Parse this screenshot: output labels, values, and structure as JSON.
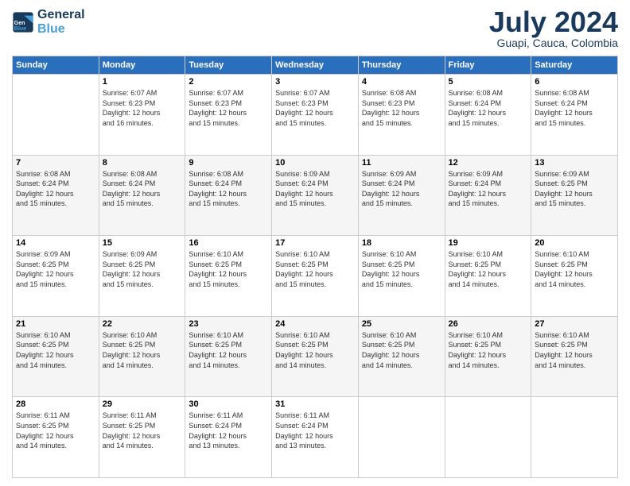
{
  "header": {
    "logo_line1": "General",
    "logo_line2": "Blue",
    "month": "July 2024",
    "location": "Guapi, Cauca, Colombia"
  },
  "weekdays": [
    "Sunday",
    "Monday",
    "Tuesday",
    "Wednesday",
    "Thursday",
    "Friday",
    "Saturday"
  ],
  "weeks": [
    [
      {
        "day": "",
        "info": ""
      },
      {
        "day": "1",
        "info": "Sunrise: 6:07 AM\nSunset: 6:23 PM\nDaylight: 12 hours\nand 16 minutes."
      },
      {
        "day": "2",
        "info": "Sunrise: 6:07 AM\nSunset: 6:23 PM\nDaylight: 12 hours\nand 15 minutes."
      },
      {
        "day": "3",
        "info": "Sunrise: 6:07 AM\nSunset: 6:23 PM\nDaylight: 12 hours\nand 15 minutes."
      },
      {
        "day": "4",
        "info": "Sunrise: 6:08 AM\nSunset: 6:23 PM\nDaylight: 12 hours\nand 15 minutes."
      },
      {
        "day": "5",
        "info": "Sunrise: 6:08 AM\nSunset: 6:24 PM\nDaylight: 12 hours\nand 15 minutes."
      },
      {
        "day": "6",
        "info": "Sunrise: 6:08 AM\nSunset: 6:24 PM\nDaylight: 12 hours\nand 15 minutes."
      }
    ],
    [
      {
        "day": "7",
        "info": "Sunrise: 6:08 AM\nSunset: 6:24 PM\nDaylight: 12 hours\nand 15 minutes."
      },
      {
        "day": "8",
        "info": "Sunrise: 6:08 AM\nSunset: 6:24 PM\nDaylight: 12 hours\nand 15 minutes."
      },
      {
        "day": "9",
        "info": "Sunrise: 6:08 AM\nSunset: 6:24 PM\nDaylight: 12 hours\nand 15 minutes."
      },
      {
        "day": "10",
        "info": "Sunrise: 6:09 AM\nSunset: 6:24 PM\nDaylight: 12 hours\nand 15 minutes."
      },
      {
        "day": "11",
        "info": "Sunrise: 6:09 AM\nSunset: 6:24 PM\nDaylight: 12 hours\nand 15 minutes."
      },
      {
        "day": "12",
        "info": "Sunrise: 6:09 AM\nSunset: 6:24 PM\nDaylight: 12 hours\nand 15 minutes."
      },
      {
        "day": "13",
        "info": "Sunrise: 6:09 AM\nSunset: 6:25 PM\nDaylight: 12 hours\nand 15 minutes."
      }
    ],
    [
      {
        "day": "14",
        "info": "Sunrise: 6:09 AM\nSunset: 6:25 PM\nDaylight: 12 hours\nand 15 minutes."
      },
      {
        "day": "15",
        "info": "Sunrise: 6:09 AM\nSunset: 6:25 PM\nDaylight: 12 hours\nand 15 minutes."
      },
      {
        "day": "16",
        "info": "Sunrise: 6:10 AM\nSunset: 6:25 PM\nDaylight: 12 hours\nand 15 minutes."
      },
      {
        "day": "17",
        "info": "Sunrise: 6:10 AM\nSunset: 6:25 PM\nDaylight: 12 hours\nand 15 minutes."
      },
      {
        "day": "18",
        "info": "Sunrise: 6:10 AM\nSunset: 6:25 PM\nDaylight: 12 hours\nand 15 minutes."
      },
      {
        "day": "19",
        "info": "Sunrise: 6:10 AM\nSunset: 6:25 PM\nDaylight: 12 hours\nand 14 minutes."
      },
      {
        "day": "20",
        "info": "Sunrise: 6:10 AM\nSunset: 6:25 PM\nDaylight: 12 hours\nand 14 minutes."
      }
    ],
    [
      {
        "day": "21",
        "info": "Sunrise: 6:10 AM\nSunset: 6:25 PM\nDaylight: 12 hours\nand 14 minutes."
      },
      {
        "day": "22",
        "info": "Sunrise: 6:10 AM\nSunset: 6:25 PM\nDaylight: 12 hours\nand 14 minutes."
      },
      {
        "day": "23",
        "info": "Sunrise: 6:10 AM\nSunset: 6:25 PM\nDaylight: 12 hours\nand 14 minutes."
      },
      {
        "day": "24",
        "info": "Sunrise: 6:10 AM\nSunset: 6:25 PM\nDaylight: 12 hours\nand 14 minutes."
      },
      {
        "day": "25",
        "info": "Sunrise: 6:10 AM\nSunset: 6:25 PM\nDaylight: 12 hours\nand 14 minutes."
      },
      {
        "day": "26",
        "info": "Sunrise: 6:10 AM\nSunset: 6:25 PM\nDaylight: 12 hours\nand 14 minutes."
      },
      {
        "day": "27",
        "info": "Sunrise: 6:10 AM\nSunset: 6:25 PM\nDaylight: 12 hours\nand 14 minutes."
      }
    ],
    [
      {
        "day": "28",
        "info": "Sunrise: 6:11 AM\nSunset: 6:25 PM\nDaylight: 12 hours\nand 14 minutes."
      },
      {
        "day": "29",
        "info": "Sunrise: 6:11 AM\nSunset: 6:25 PM\nDaylight: 12 hours\nand 14 minutes."
      },
      {
        "day": "30",
        "info": "Sunrise: 6:11 AM\nSunset: 6:24 PM\nDaylight: 12 hours\nand 13 minutes."
      },
      {
        "day": "31",
        "info": "Sunrise: 6:11 AM\nSunset: 6:24 PM\nDaylight: 12 hours\nand 13 minutes."
      },
      {
        "day": "",
        "info": ""
      },
      {
        "day": "",
        "info": ""
      },
      {
        "day": "",
        "info": ""
      }
    ]
  ]
}
